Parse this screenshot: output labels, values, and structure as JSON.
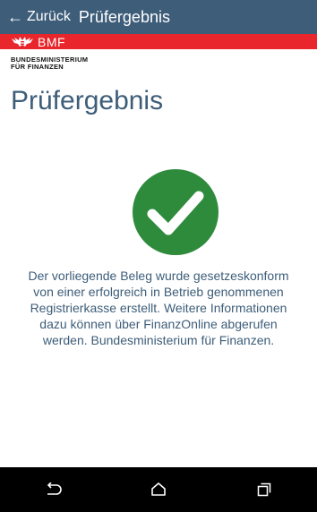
{
  "appbar": {
    "back_label": "Zurück",
    "title": "Prüfergebnis"
  },
  "brand": {
    "logo_text": "BMF",
    "ministry_line1": "BUNDESMINISTERIUM",
    "ministry_line2": "FÜR FINANZEN",
    "accent_color": "#e8262b"
  },
  "page": {
    "title": "Prüfergebnis",
    "result_icon": "check-icon",
    "result_color": "#2e8b3c",
    "message_lines": [
      "Der vorliegende Beleg wurde gesetzeskonform",
      "von einer erfolgreich in Betrieb genommenen",
      "Registrierkasse erstellt. Weitere Informationen",
      "dazu können über FinanzOnline abgerufen",
      "werden. Bundesministerium für Finanzen."
    ]
  },
  "navbar": {
    "icons": [
      "back-nav-icon",
      "home-nav-icon",
      "recents-nav-icon"
    ]
  },
  "colors": {
    "primary": "#3d5d79"
  }
}
